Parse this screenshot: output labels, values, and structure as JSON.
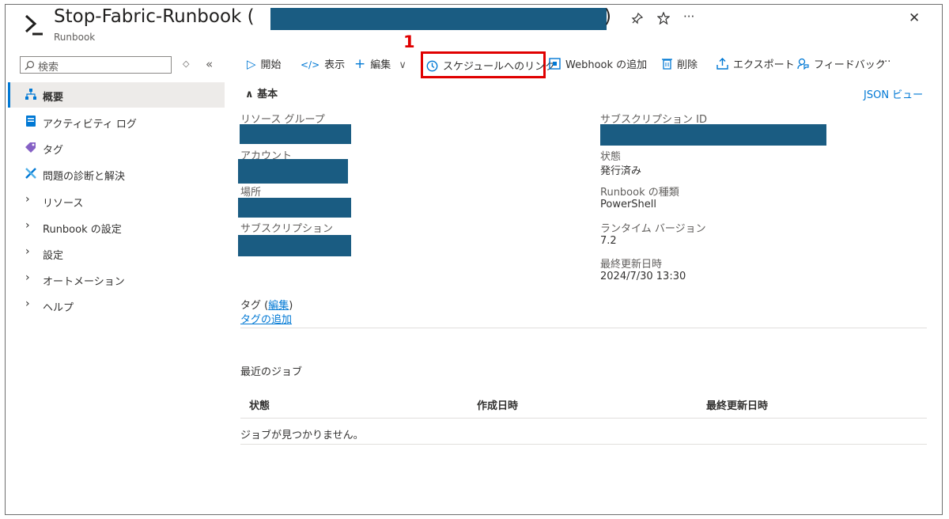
{
  "header": {
    "title": "Stop-Fabric-Runbook (",
    "title_close": ")",
    "subtitle": "Runbook",
    "pin_icon": "pin-icon",
    "star_icon": "star-icon",
    "more": "···",
    "close": "✕"
  },
  "sidebar": {
    "search_placeholder": "検索",
    "items": [
      {
        "label": "概要",
        "icon": "hierarchy-icon",
        "selected": true
      },
      {
        "label": "アクティビティ ログ",
        "icon": "log-icon"
      },
      {
        "label": "タグ",
        "icon": "tag-icon"
      },
      {
        "label": "問題の診断と解決",
        "icon": "wrench-icon"
      },
      {
        "label": "リソース",
        "expandable": true
      },
      {
        "label": "Runbook の設定",
        "expandable": true
      },
      {
        "label": "設定",
        "expandable": true
      },
      {
        "label": "オートメーション",
        "expandable": true
      },
      {
        "label": "ヘルプ",
        "expandable": true
      }
    ]
  },
  "toolbar": {
    "start": "開始",
    "view": "表示",
    "edit": "編集",
    "link_schedule": "スケジュールへのリンク",
    "add_webhook": "Webhook の追加",
    "delete": "削除",
    "export": "エクスポート",
    "feedback": "フィードバック",
    "more": "···"
  },
  "annotation": {
    "step": "1",
    "color": "#e00000"
  },
  "essentials": {
    "section_title": "基本",
    "json_view": "JSON ビュー",
    "left": [
      {
        "label": "リソース グループ"
      },
      {
        "label": "アカウント"
      },
      {
        "label": "場所"
      },
      {
        "label": "サブスクリプション"
      }
    ],
    "right": [
      {
        "label": "サブスクリプション ID"
      },
      {
        "label": "状態",
        "value": "発行済み"
      },
      {
        "label": "Runbook の種類",
        "value": "PowerShell"
      },
      {
        "label": "ランタイム バージョン",
        "value": "7.2"
      },
      {
        "label": "最終更新日時",
        "value": "2024/7/30 13:30"
      }
    ],
    "tags_label": "タグ (",
    "tags_edit": "編集",
    "tags_close": ")",
    "add_tag": "タグの追加"
  },
  "jobs": {
    "title": "最近のジョブ",
    "columns": [
      "状態",
      "作成日時",
      "最終更新日時"
    ],
    "empty": "ジョブが見つかりません。"
  },
  "colors": {
    "accent": "#0078d4",
    "redaction": "#1a5c82",
    "highlight": "#e00000"
  }
}
